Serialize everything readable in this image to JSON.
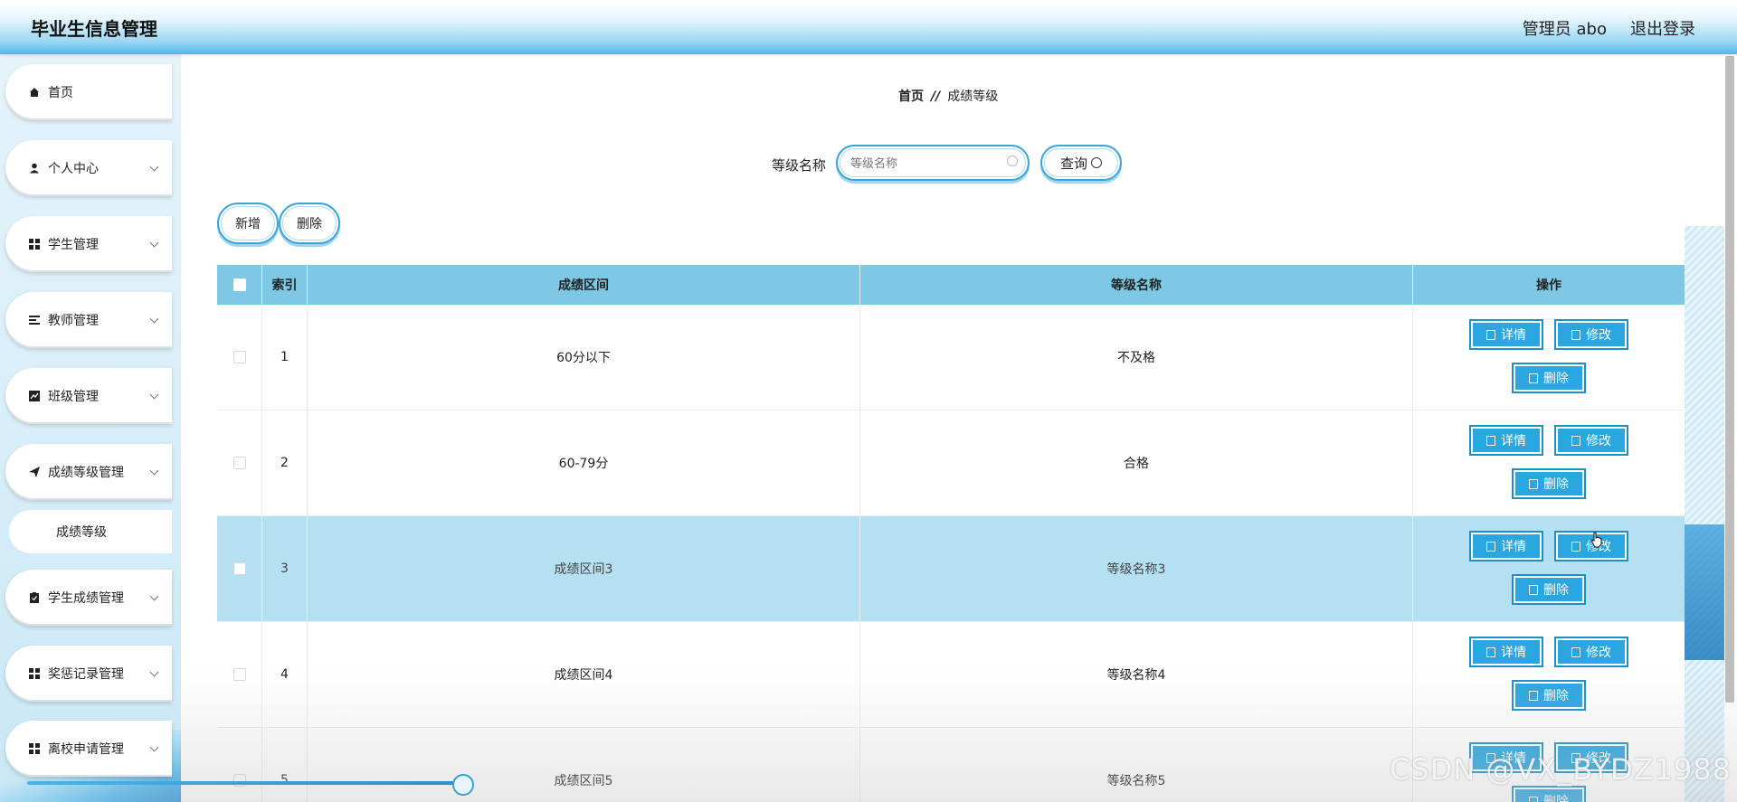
{
  "header": {
    "title": "毕业生信息管理",
    "user": "管理员 abo",
    "logout": "退出登录"
  },
  "sidebar": {
    "items": [
      {
        "label": "首页",
        "icon": "home-icon"
      },
      {
        "label": "个人中心",
        "icon": "user-icon"
      },
      {
        "label": "学生管理",
        "icon": "grid-icon"
      },
      {
        "label": "教师管理",
        "icon": "list-icon"
      },
      {
        "label": "班级管理",
        "icon": "chart-icon"
      },
      {
        "label": "成绩等级管理",
        "icon": "send-icon"
      },
      {
        "label": "学生成绩管理",
        "icon": "clipboard-icon"
      },
      {
        "label": "奖惩记录管理",
        "icon": "grid-icon"
      },
      {
        "label": "离校申请管理",
        "icon": "grid-icon"
      }
    ],
    "subitem": "成绩等级"
  },
  "breadcrumb": {
    "home": "首页",
    "sep": "//",
    "current": "成绩等级"
  },
  "search": {
    "label": "等级名称",
    "placeholder": "等级名称",
    "button": "查询"
  },
  "actions": {
    "add": "新增",
    "delete": "删除"
  },
  "table": {
    "headers": [
      "索引",
      "成绩区间",
      "等级名称",
      "操作"
    ],
    "rows": [
      {
        "index": "1",
        "range": "60分以下",
        "name": "不及格"
      },
      {
        "index": "2",
        "range": "60-79分",
        "name": "合格"
      },
      {
        "index": "3",
        "range": "成绩区间3",
        "name": "等级名称3"
      },
      {
        "index": "4",
        "range": "成绩区间4",
        "name": "等级名称4"
      },
      {
        "index": "5",
        "range": "成绩区间5",
        "name": "等级名称5"
      }
    ],
    "ops": {
      "detail": "详情",
      "edit": "修改",
      "delete": "删除"
    }
  },
  "watermark": "CSDN @VX_BYDZ1988",
  "colors": {
    "accent": "#2aa6e0",
    "header_row": "#7ec8e6",
    "highlight_row": "#b5e0f2"
  }
}
